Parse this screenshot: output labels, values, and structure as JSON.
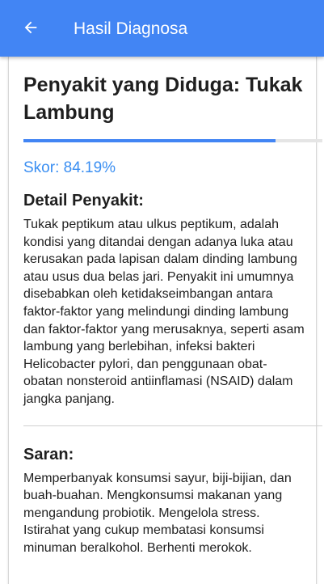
{
  "appbar": {
    "title": "Hasil Diagnosa",
    "back_icon": "arrow-left-icon",
    "color": "#4285f4"
  },
  "result": {
    "title": "Penyakit yang Diduga: Tukak Lambung",
    "score_label": "Skor: 84.19%",
    "score_fraction": 0.8419,
    "accent_color": "#3b8ff2"
  },
  "detail": {
    "heading": "Detail Penyakit:",
    "text": "Tukak peptikum atau ulkus peptikum, adalah kondisi yang ditandai dengan adanya luka atau kerusakan pada lapisan dalam dinding lambung atau usus dua belas jari. Penyakit ini umumnya disebabkan oleh ketidakseimbangan antara faktor-faktor yang melindungi dinding lambung dan faktor-faktor yang merusaknya, seperti asam lambung yang berlebihan, infeksi bakteri Helicobacter pylori, dan penggunaan obat-obatan nonsteroid antiinflamasi (NSAID) dalam jangka panjang."
  },
  "saran": {
    "heading": "Saran:",
    "text": "Memperbanyak konsumsi sayur, biji-bijian, dan buah-buahan. Mengkonsumsi makanan yang mengandung probiotik. Mengelola stress. Istirahat yang cukup membatasi konsumsi minuman beralkohol. Berhenti merokok."
  }
}
